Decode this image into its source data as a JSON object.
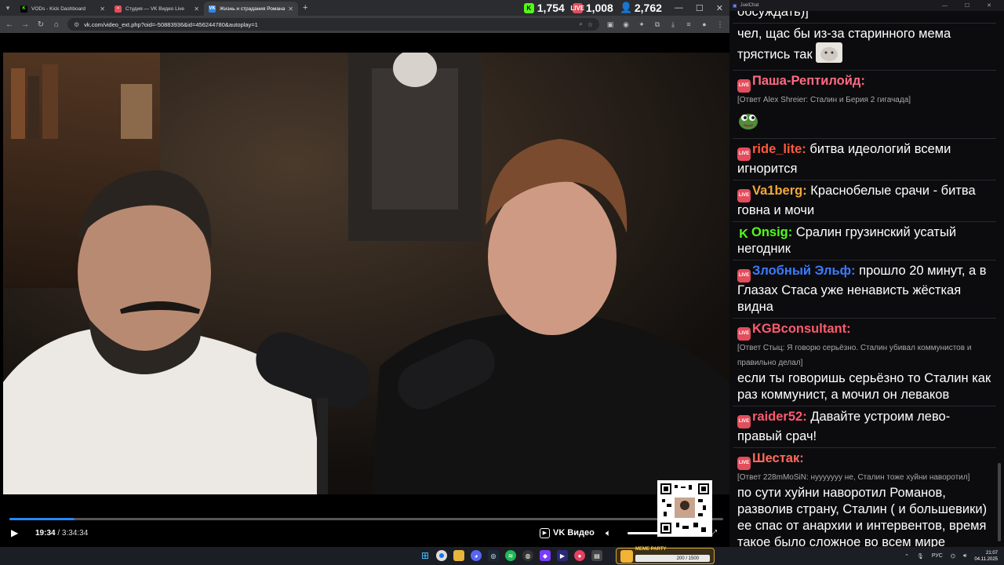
{
  "browser": {
    "tabs": [
      {
        "title": "VODs - Kick Dashboard",
        "favicon_color": "#53fc18",
        "favicon_glyph": "K",
        "active": false
      },
      {
        "title": "Студия — VK Видео Live",
        "favicon_color": "#e44d5b",
        "favicon_glyph": "•",
        "active": false
      },
      {
        "title": "Жизнь и страдания Романа Ан",
        "favicon_color": "#2787f5",
        "favicon_glyph": "VK",
        "active": true
      }
    ],
    "new_tab": "+",
    "url": "vk.com/video_ext.php?oid=-50883936&id=456244780&autoplay=1"
  },
  "stats": {
    "kick_viewers": "1,754",
    "vk_viewers": "1,008",
    "total_viewers": "2,762"
  },
  "player": {
    "current_time": "19:34",
    "duration": "/ 3:34:34",
    "progress_fraction": 0.091,
    "brand": "VK Видео",
    "volume_fraction": 1.0
  },
  "chat": {
    "window_title": "JuelChat",
    "messages": [
      {
        "platform": "none",
        "user": "",
        "user_color": "#ffffff",
        "reply": "",
        "text": "обсуждать)]"
      },
      {
        "platform": "none",
        "user": "",
        "user_color": "#ffffff",
        "reply": "",
        "text": "чел, щас бы из-за старинного мема трястись так",
        "emote": "cat"
      },
      {
        "platform": "vk",
        "user": "Паша-Рептилойд:",
        "user_color": "#ff6b81",
        "reply": "[Ответ Alex Shreier: Сталин и Берия 2 гигачада]",
        "text": "",
        "emote": "pepe"
      },
      {
        "platform": "vk",
        "user": "ride_lite:",
        "user_color": "#ff5a3c",
        "reply": "",
        "text": "битва идеологий всеми игнорится"
      },
      {
        "platform": "vk",
        "user": "Va1berg:",
        "user_color": "#f1a83a",
        "reply": "",
        "text": "Краснобелые срачи - битва говна и мочи"
      },
      {
        "platform": "kick",
        "user": "Onsig:",
        "user_color": "#53fc18",
        "reply": "",
        "text": "Сралин грузинский усатый негодник"
      },
      {
        "platform": "vk",
        "user": "Злобный Эльф:",
        "user_color": "#3b7bff",
        "reply": "",
        "text": "прошло 20 минут, а в Глазах Стаса уже ненависть жёсткая видна"
      },
      {
        "platform": "vk",
        "user": "KGBconsultant:",
        "user_color": "#ff5a6e",
        "reply": "[Ответ Стыц: Я говорю серьёзно. Сталин убивал коммунистов и правильно делал]",
        "text": "если ты говоришь серьёзно то Сталин как раз коммунист, а мочил он леваков"
      },
      {
        "platform": "vk",
        "user": "raider52:",
        "user_color": "#ff5a6e",
        "reply": "",
        "text": "Давайте устроим лево-правый срач!"
      },
      {
        "platform": "vk",
        "user": "Шестак:",
        "user_color": "#ff6b5a",
        "reply": "[Ответ 228mMoSiN: нууууууу не, Сталин тоже хуйни наворотил]",
        "text": "по сути хуйни наворотил Романов, разволив страну, Сталин ( и большевики) ее спас от анархии и интервентов, время такое было сложное во всем мире"
      }
    ]
  },
  "taskbar": {
    "meme_label": "MEME PARTY",
    "meme_progress": "200 / 1500",
    "lang": "РУС",
    "time": "21:07",
    "date": "04.11.2025"
  },
  "icons": {
    "back": "arrow-left-icon",
    "forward": "arrow-right-icon",
    "reload": "reload-icon",
    "home": "home-icon",
    "play": "play-icon",
    "volume": "speaker-icon",
    "fullscreen": "fullscreen-icon"
  }
}
